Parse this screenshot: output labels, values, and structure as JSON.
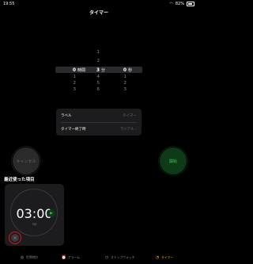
{
  "status_bar": {
    "time": "19:55",
    "battery": "82%"
  },
  "nav": {
    "title": "タイマー"
  },
  "picker": {
    "hours": {
      "above": [
        "",
        ""
      ],
      "selected": "0",
      "below": [
        "1",
        "2",
        "3"
      ],
      "unit": "時間"
    },
    "minutes": {
      "above": [
        "1",
        "2"
      ],
      "selected": "3",
      "below": [
        "4",
        "5",
        "6"
      ],
      "unit": "分"
    },
    "seconds": {
      "above": [
        "",
        ""
      ],
      "selected": "0",
      "below": [
        "1",
        "2",
        "3"
      ],
      "unit": "秒"
    }
  },
  "settings": {
    "label_title": "ラベル",
    "label_value": "タイマー",
    "end_title": "タイマー終了時",
    "end_value": "ラジアル",
    "chevron": "›"
  },
  "buttons": {
    "cancel": "キャンセル",
    "start": "開始"
  },
  "recent": {
    "title": "最近使った項目",
    "time": "03:00",
    "subtitle": "3分"
  },
  "tabs": [
    {
      "label": "世界時計",
      "icon": "globe-icon"
    },
    {
      "label": "アラーム",
      "icon": "alarm-icon"
    },
    {
      "label": "ストップウォッチ",
      "icon": "stopwatch-icon"
    },
    {
      "label": "タイマー",
      "icon": "timer-icon",
      "active": true
    }
  ],
  "colors": {
    "accent": "#ff9f0a",
    "green": "#30d158",
    "highlight_ring": "#e0141e"
  }
}
